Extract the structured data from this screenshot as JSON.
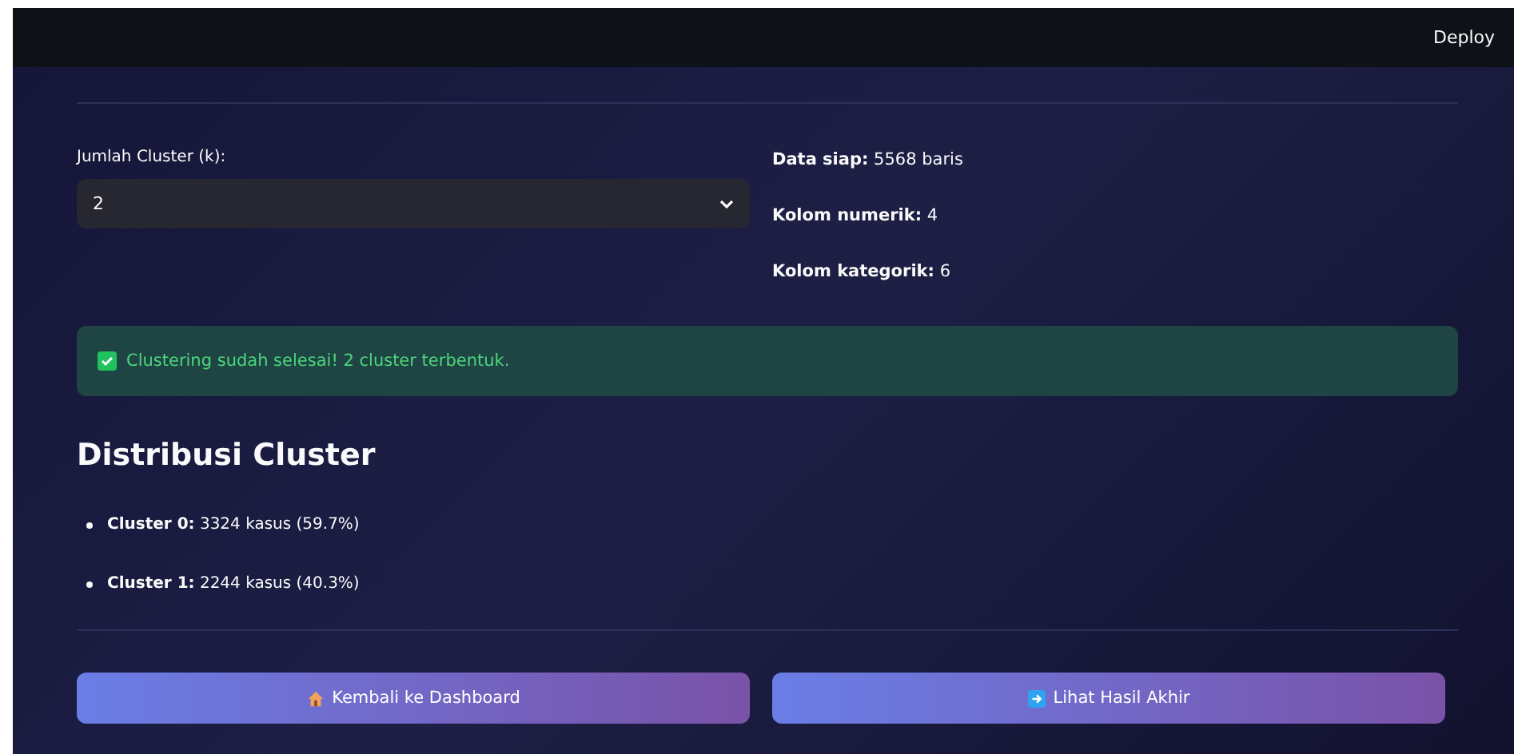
{
  "header": {
    "deploy": "Deploy"
  },
  "select": {
    "label": "Jumlah Cluster (k):",
    "value": "2"
  },
  "info": [
    "**Data siap:** 5568 baris",
    "**Kolom numerik:** 4",
    "**Kolom kategorik:** 6"
  ],
  "alert": {
    "kind": "success",
    "text": "Clustering sudah selesai! 2 cluster terbentuk."
  },
  "heading": "Distribusi Cluster",
  "bullets": [
    "**Cluster 0:** 3324 kasus (59.7%)",
    "**Cluster 1:** 2244 kasus (40.3%)"
  ],
  "buttons": [
    {
      "kind": "home",
      "label": "Kembali ke Dashboard"
    },
    {
      "kind": "arrow",
      "label": "Lihat Hasil Akhir"
    }
  ]
}
